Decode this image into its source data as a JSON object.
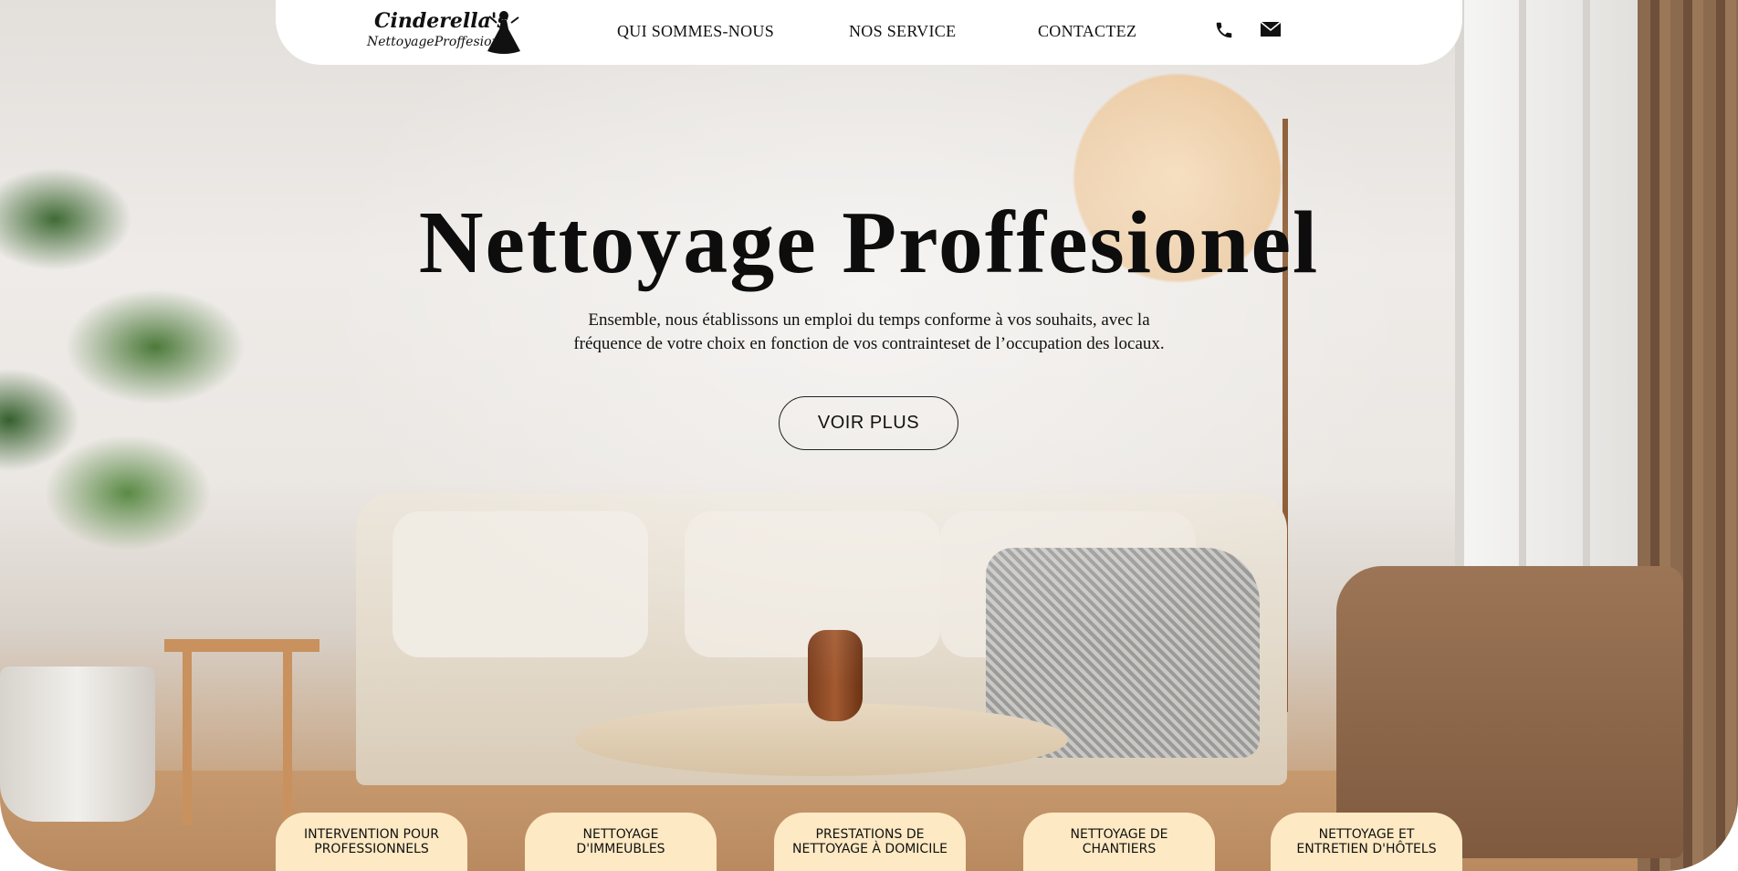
{
  "header": {
    "logo": {
      "name": "Cinderella's",
      "tagline": "NettoyageProffesionel"
    },
    "nav": [
      {
        "label": "QUI SOMMES-NOUS"
      },
      {
        "label": "NOS SERVICE"
      },
      {
        "label": "CONTACTEZ"
      }
    ],
    "icons": {
      "phone": "phone-icon",
      "mail": "mail-icon"
    }
  },
  "hero": {
    "title": "Nettoyage Proffesionel",
    "subtitle": "Ensemble, nous établissons un emploi du temps conforme à vos souhaits, avec la fréquence de votre choix en fonction de vos contrainteset de l’occupation des locaux.",
    "cta_label": "VOIR PLUS"
  },
  "services": [
    {
      "label": "INTERVENTION POUR PROFESSIONNELS"
    },
    {
      "label": "NETTOYAGE D'IMMEUBLES"
    },
    {
      "label": "PRESTATIONS DE NETTOYAGE À DOMICILE"
    },
    {
      "label": "NETTOYAGE DE CHANTIERS"
    },
    {
      "label": "NETTOYAGE ET ENTRETIEN D'HÔTELS"
    }
  ],
  "colors": {
    "tab_background": "#fde9c3",
    "header_background": "#ffffff",
    "text": "#111111"
  }
}
